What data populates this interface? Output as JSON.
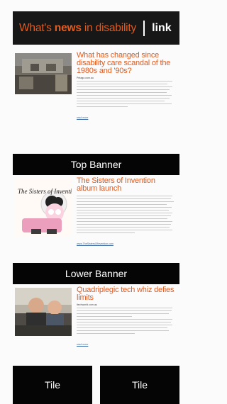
{
  "masthead": {
    "brand_prefix": "What's ",
    "brand_bold": "news",
    "brand_suffix": " in disability",
    "link": "link"
  },
  "stories": [
    {
      "headline": "What has changed since disability care scandal of the 1980s and '90s?",
      "source": "Pelago.com.au",
      "read_more": "read more"
    },
    {
      "headline": "The Sisters of Invention album launch",
      "artwork_text": "The Sisters of Invention",
      "read_more": "www.TheSistersOfInvention.com",
      "source": ""
    },
    {
      "headline": "Quadriplegic tech whiz defies limits",
      "source": "itechworld.com.au",
      "read_more": "read more"
    }
  ],
  "banners": {
    "top": "Top Banner",
    "lower": "Lower Banner"
  },
  "tiles": [
    "Tile",
    "Tile"
  ],
  "colors": {
    "accent": "#e35b1e",
    "dark": "#050505"
  }
}
